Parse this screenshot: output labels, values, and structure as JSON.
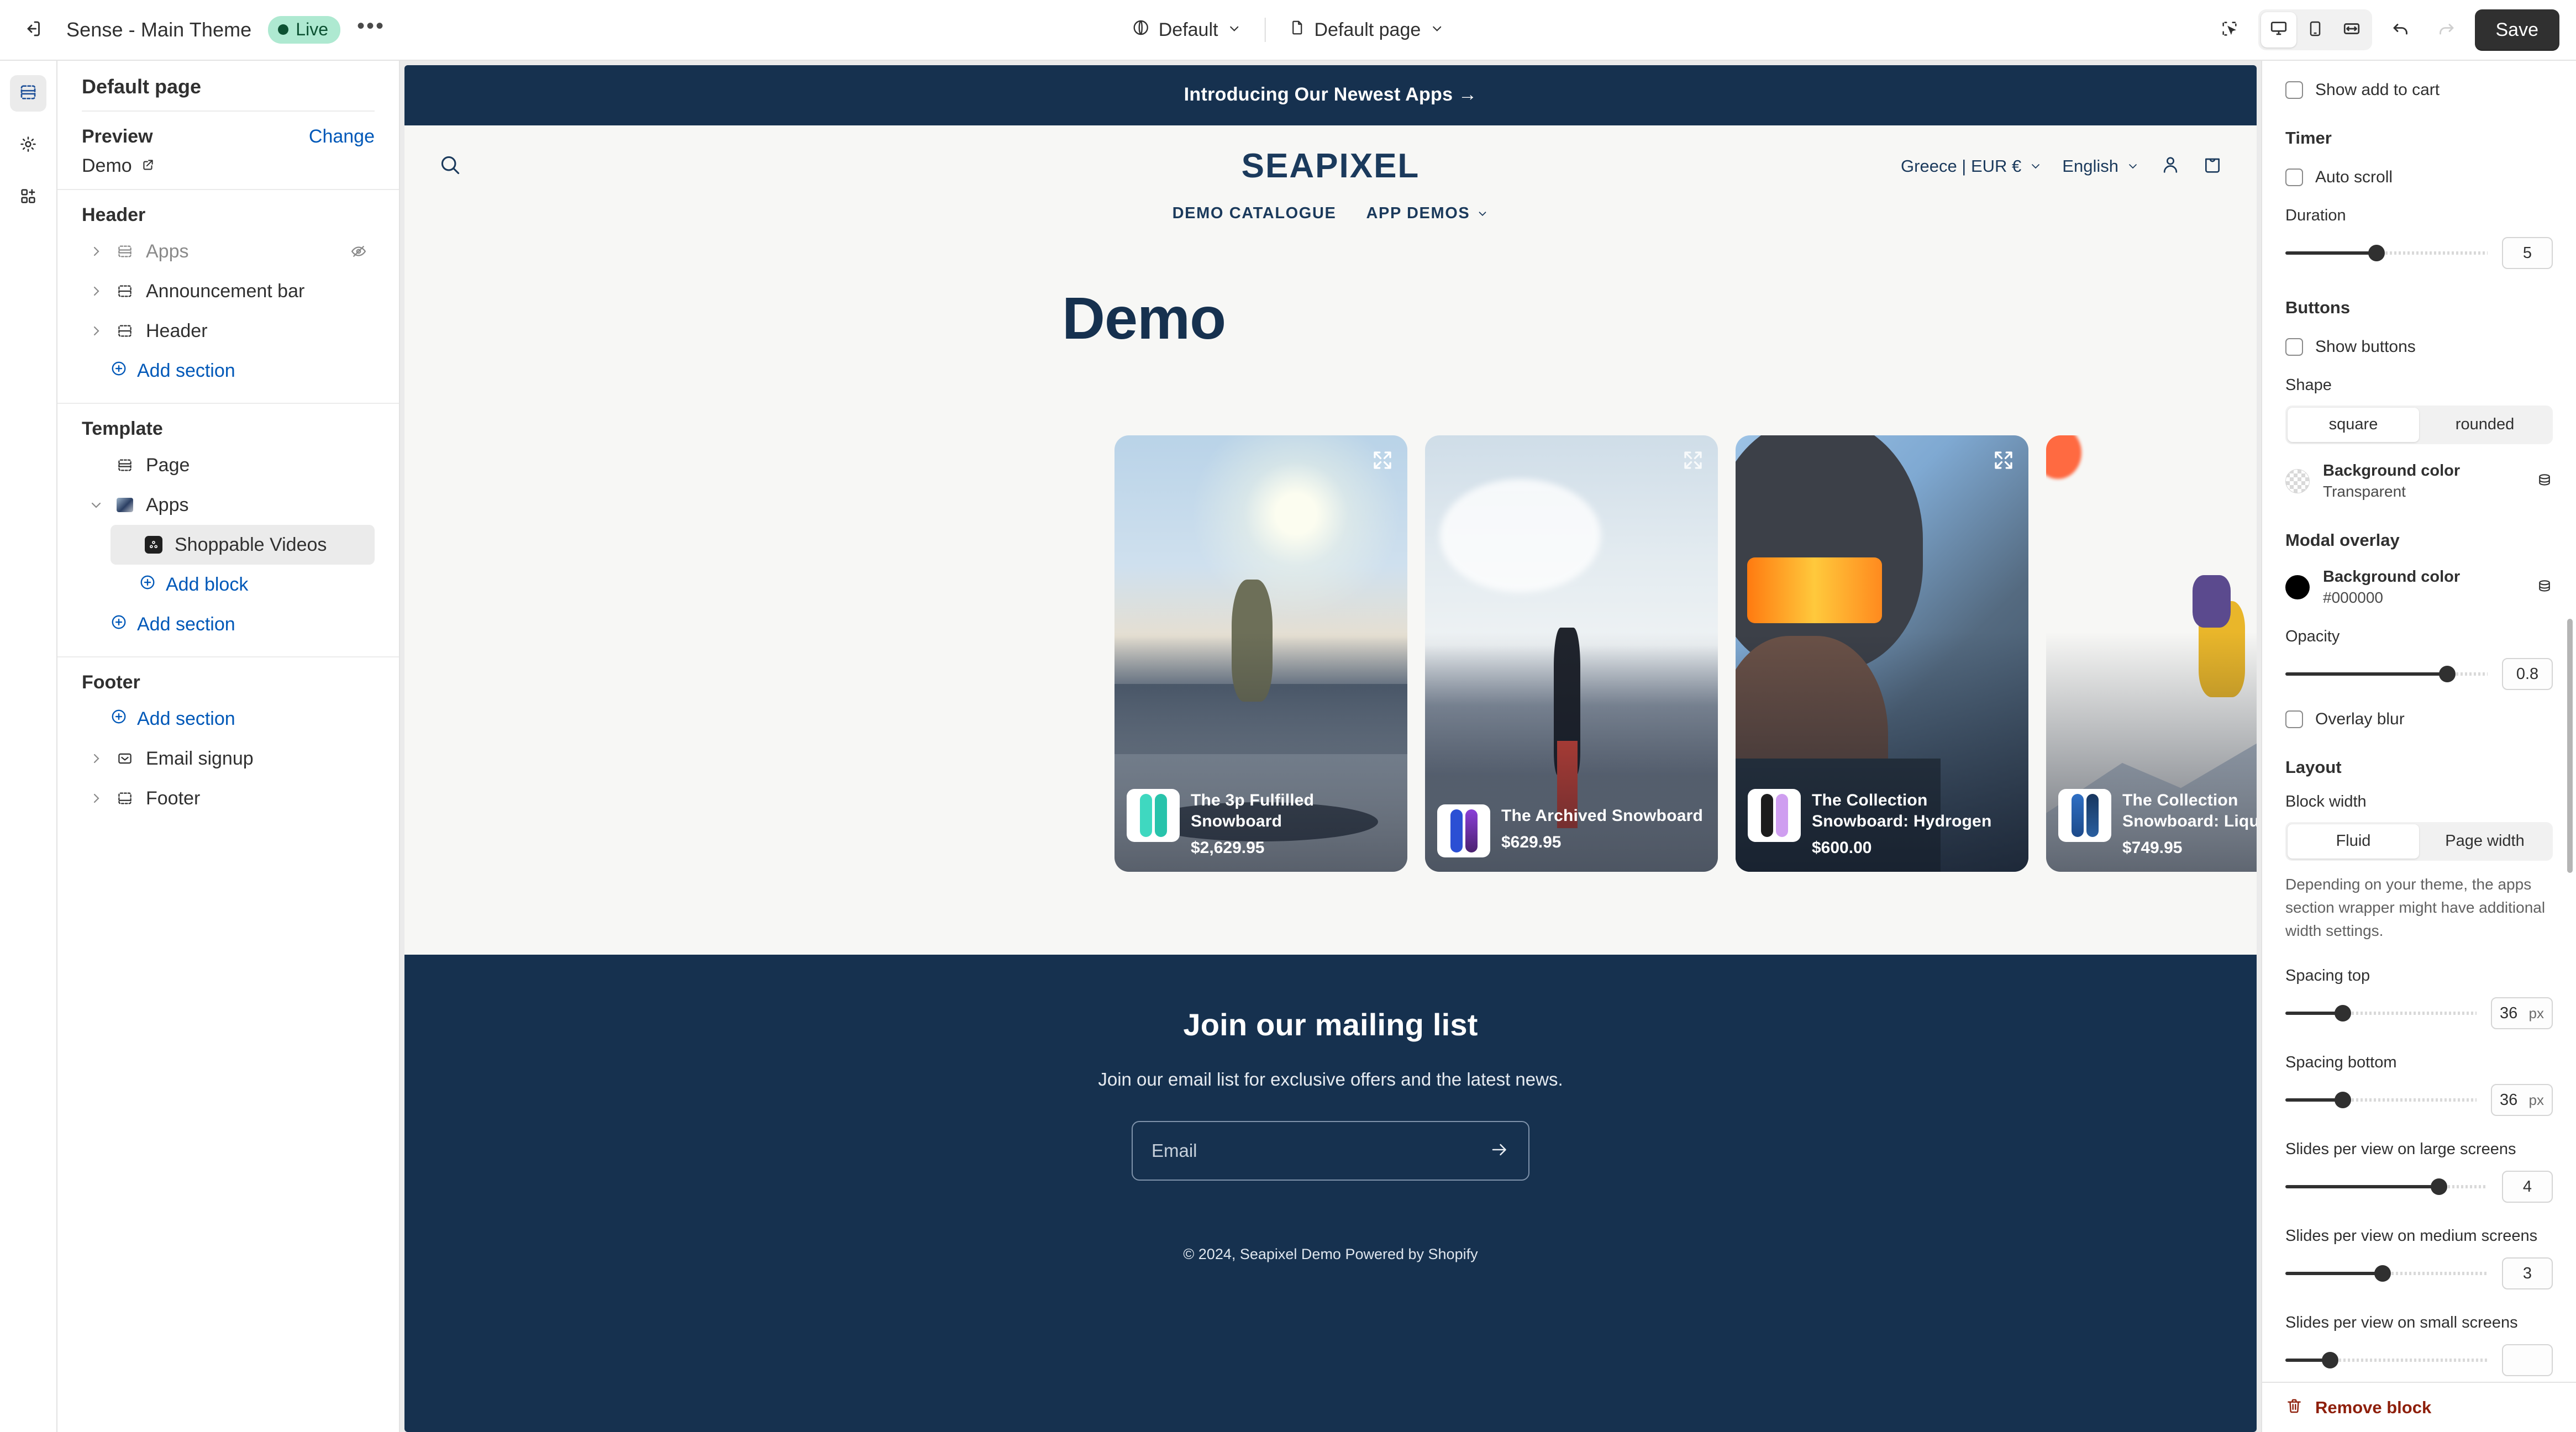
{
  "topbar": {
    "exit_icon": "exit-icon",
    "theme_name": "Sense - Main Theme",
    "status_badge": "Live",
    "more_label": "•••",
    "market_label": "Default",
    "page_label": "Default page",
    "save_label": "Save",
    "devices": [
      "desktop",
      "mobile",
      "fullwidth"
    ]
  },
  "sidebar": {
    "page_title": "Default page",
    "preview_label": "Preview",
    "change_label": "Change",
    "preview_value": "Demo",
    "groups": [
      {
        "label": "Header",
        "items": [
          {
            "label": "Apps",
            "icon": "apps-section-icon",
            "caret": true,
            "hidden": true
          },
          {
            "label": "Announcement bar",
            "icon": "section-icon",
            "caret": true,
            "hidden": false
          },
          {
            "label": "Header",
            "icon": "section-icon",
            "caret": true,
            "hidden": false
          }
        ],
        "add_label": "Add section"
      },
      {
        "label": "Template",
        "items": [
          {
            "label": "Page",
            "icon": "page-section-icon",
            "caret": false,
            "hidden": false
          },
          {
            "label": "Apps",
            "icon": "app-thumb-icon",
            "caret": true,
            "expanded": true,
            "hidden": false
          }
        ],
        "child": {
          "label": "Shoppable Videos",
          "icon": "shoppable-videos-app-icon",
          "selected": true
        },
        "add_block_label": "Add block",
        "add_label": "Add section"
      },
      {
        "label": "Footer",
        "add_label": "Add section",
        "items": [
          {
            "label": "Email signup",
            "icon": "envelope-icon",
            "caret": true,
            "hidden": false
          },
          {
            "label": "Footer",
            "icon": "footer-section-icon",
            "caret": true,
            "hidden": false
          }
        ]
      }
    ]
  },
  "preview": {
    "announcement": "Introducing Our Newest Apps  →",
    "brand": "SEAPIXEL",
    "search_icon": "search-icon",
    "locale": "Greece | EUR €",
    "language": "English",
    "account_icon": "account-icon",
    "cart_icon": "cart-icon",
    "nav": [
      "DEMO CATALOGUE",
      "APP DEMOS"
    ],
    "page_heading": "Demo",
    "cards": [
      {
        "name": "The 3p Fulfilled Snowboard",
        "price": "$2,629.95",
        "sky_top": "#b9d3e8",
        "sky_bot": "#e9eef2",
        "ground": "#8794a4",
        "board1": "#3fd8c0",
        "board2": "#28c3ab"
      },
      {
        "name": "The Archived Snowboard",
        "price": "$629.95",
        "sky_top": "#cfdde8",
        "sky_bot": "#e6ecf0",
        "ground": "#8e99a8",
        "board1": "#2b4fd4",
        "board2": "#8b3fd8"
      },
      {
        "name": "The Collection Snowboard: Hydrogen",
        "price": "$600.00",
        "sky_top": "#9dc3e6",
        "sky_bot": "#5c6f83",
        "ground": "#3b4a5c",
        "board1": "#1c1c1c",
        "board2": "#cf9ef0"
      },
      {
        "name": "The Collection Snowboard: Liquid",
        "price": "$749.95",
        "sky_top": "#2e4a6e",
        "sky_bot": "#8f9eb0",
        "ground": "#b9c4d0",
        "board1": "#2f6fc4",
        "board2": "#17365f"
      }
    ],
    "footer": {
      "title": "Join our mailing list",
      "subtitle": "Join our email list for exclusive offers and the latest news.",
      "email_placeholder": "Email",
      "submit_icon": "arrow-right-icon",
      "copyright": "© 2024, Seapixel Demo Powered by Shopify"
    }
  },
  "inspector": {
    "show_add_to_cart": "Show add to cart",
    "timer_heading": "Timer",
    "auto_scroll": "Auto scroll",
    "duration_label": "Duration",
    "duration_value": "5",
    "duration_pct": 45,
    "buttons_heading": "Buttons",
    "show_buttons": "Show buttons",
    "shape_label": "Shape",
    "shape_options": [
      "square",
      "rounded"
    ],
    "shape_selected": "square",
    "btn_bg_name": "Background color",
    "btn_bg_value": "Transparent",
    "modal_heading": "Modal overlay",
    "modal_bg_name": "Background color",
    "modal_bg_value": "#000000",
    "modal_bg_hex": "#000000",
    "opacity_label": "Opacity",
    "opacity_value": "0.8",
    "opacity_pct": 80,
    "overlay_blur": "Overlay blur",
    "layout_heading": "Layout",
    "block_width_label": "Block width",
    "block_width_options": [
      "Fluid",
      "Page width"
    ],
    "block_width_selected": "Fluid",
    "helper_text": "Depending on your theme, the apps section wrapper might have additional width settings.",
    "spacing_top_label": "Spacing top",
    "spacing_top_value": "36",
    "spacing_top_unit": "px",
    "spacing_top_pct": 30,
    "spacing_bottom_label": "Spacing bottom",
    "spacing_bottom_value": "36",
    "spacing_bottom_unit": "px",
    "spacing_bottom_pct": 30,
    "slides_large_label": "Slides per view on large screens",
    "slides_large_value": "4",
    "slides_large_pct": 76,
    "slides_medium_label": "Slides per view on medium screens",
    "slides_medium_value": "3",
    "slides_medium_pct": 48,
    "slides_small_label": "Slides per view on small screens",
    "remove_label": "Remove block",
    "remove_icon": "trash-icon"
  }
}
